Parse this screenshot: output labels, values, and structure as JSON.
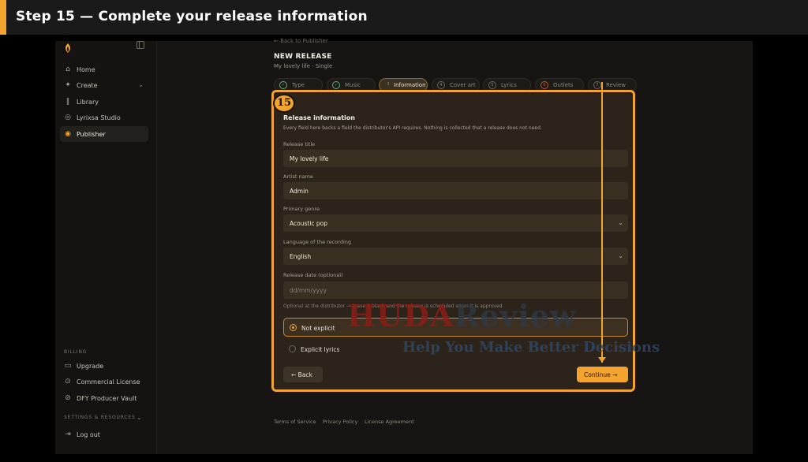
{
  "banner": {
    "title": "Step 15 — Complete your release information"
  },
  "sidebar": {
    "items": [
      {
        "label": "Home",
        "icon": "home-icon"
      },
      {
        "label": "Create",
        "icon": "sparkle-icon"
      },
      {
        "label": "Library",
        "icon": "library-icon"
      },
      {
        "label": "Lyrixsa Studio",
        "icon": "studio-icon"
      },
      {
        "label": "Publisher",
        "icon": "broadcast-icon"
      }
    ],
    "billing_heading": "BILLING",
    "billing_items": [
      {
        "label": "Upgrade",
        "icon": "card-icon"
      },
      {
        "label": "Commercial License",
        "icon": "check-circle-icon"
      },
      {
        "label": "DFY Producer Vault",
        "icon": "vault-icon"
      }
    ],
    "settings_heading": "SETTINGS & RESOURCES",
    "logout_label": "Log out"
  },
  "header": {
    "back_link": "← Back to Publisher",
    "title": "NEW RELEASE",
    "subtitle": "My lovely life · Single"
  },
  "steps": [
    {
      "num": "✓",
      "label": "Type",
      "state": "done"
    },
    {
      "num": "✓",
      "label": "Music",
      "state": "done"
    },
    {
      "num": "3",
      "label": "Information",
      "state": "current"
    },
    {
      "num": "4",
      "label": "Cover art",
      "state": "todo"
    },
    {
      "num": "5",
      "label": "Lyrics",
      "state": "todo"
    },
    {
      "num": "6",
      "label": "Outlets",
      "state": "todo"
    },
    {
      "num": "7",
      "label": "Review",
      "state": "todo"
    }
  ],
  "form": {
    "step_badge": "15",
    "title": "Release information",
    "description": "Every field here backs a field the distributor's API requires. Nothing is collected that a release does not need.",
    "release_title_label": "Release title",
    "release_title_value": "My lovely life",
    "artist_label": "Artist name",
    "artist_value": "Admin",
    "genre_label": "Primary genre",
    "genre_value": "Acoustic pop",
    "language_label": "Language of the recording",
    "language_value": "English",
    "date_label": "Release date (optional)",
    "date_placeholder": "dd/mm/yyyy",
    "date_hint": "Optional at the distributor — leave it blank and the release is scheduled when it is approved.",
    "radio_not_explicit": "Not explicit",
    "radio_explicit": "Explicit lyrics",
    "back_button": "← Back",
    "continue_button": "Continue →"
  },
  "footer": {
    "terms": "Terms of Service",
    "privacy": "Privacy Policy",
    "license": "License Agreement"
  },
  "watermark": {
    "brand_a": "HUDA",
    "brand_b": "Review",
    "tagline": "Help You Make Better Decisions"
  },
  "colors": {
    "accent": "#f2a42f",
    "background": "#161513",
    "card": "#2c241a"
  }
}
